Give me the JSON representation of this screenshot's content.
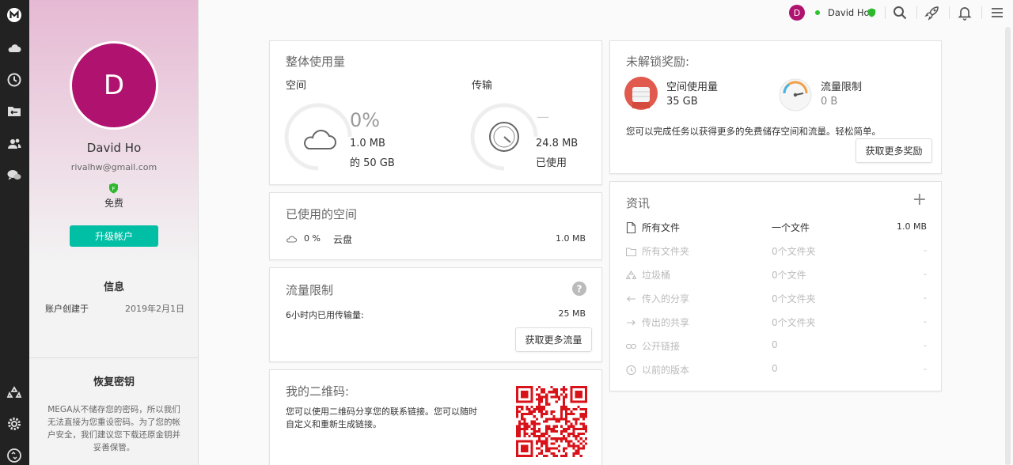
{
  "topbar": {
    "avatar_letter": "D",
    "user_name": "David Ho"
  },
  "sidebar": {
    "items": [
      {
        "icon": "mega-logo-icon"
      },
      {
        "icon": "cloud-drive-icon"
      },
      {
        "icon": "recents-clock-icon"
      },
      {
        "icon": "shared-folders-icon"
      },
      {
        "icon": "contacts-icon"
      },
      {
        "icon": "chat-icon"
      },
      {
        "icon": "rubbish-bin-icon"
      },
      {
        "icon": "settings-gear-icon"
      },
      {
        "icon": "transfer-status-icon"
      }
    ]
  },
  "profile": {
    "avatar_letter": "D",
    "name": "David Ho",
    "email": "rivalhw@gmail.com",
    "plan": "免费",
    "upgrade_label": "升级帐户",
    "info_title": "信息",
    "created_label": "账户创建于",
    "created_value": "2019年2月1日",
    "recovery_title": "恢复密钥",
    "recovery_text": "MEGA从不储存您的密码，所以我们无法直接为您重设密码。为了您的帐户安全，我们建议您下载还原金钥并妥善保管。"
  },
  "usage": {
    "title": "整体使用量",
    "space_label": "空间",
    "space_pct": "0%",
    "space_used": "1.0 MB",
    "space_total": "的 50 GB",
    "space_fraction": 0.0,
    "transfer_label": "传输",
    "transfer_pct": "—",
    "transfer_used": "24.8 MB",
    "transfer_used_label": "已使用"
  },
  "used_space": {
    "title": "已使用的空间",
    "pct": "0 %",
    "name": "云盘",
    "size": "1.0 MB"
  },
  "quota": {
    "title": "流量限制",
    "row_label": "6小时内已用传输量:",
    "row_value": "25 MB",
    "button": "获取更多流量"
  },
  "qr": {
    "title": "我的二维码:",
    "text": "您可以使用二维码分享您的联系链接。您可以随时自定义和重新生成链接。"
  },
  "rewards": {
    "title": "未解锁奖励:",
    "space_label": "空间使用量",
    "space_value": "35 GB",
    "transfer_label": "流量限制",
    "transfer_value": "0 B",
    "note": "您可以完成任务以获得更多的免费储存空间和流量。轻松简单。",
    "button": "获取更多奖励"
  },
  "info": {
    "title": "资讯",
    "add_symbol": "+",
    "rows": [
      {
        "icon": "file-icon",
        "label": "所有文件",
        "count": "一个文件",
        "size": "1.0 MB"
      },
      {
        "icon": "folder-icon",
        "label": "所有文件夹",
        "count": "0个文件夹",
        "size": "-"
      },
      {
        "icon": "rubbish-icon",
        "label": "垃圾桶",
        "count": "0个文件",
        "size": "-"
      },
      {
        "icon": "incoming-share-icon",
        "label": "传入的分享",
        "count": "0个文件夹",
        "size": "-"
      },
      {
        "icon": "outgoing-share-icon",
        "label": "传出的共享",
        "count": "0个文件夹",
        "size": "-"
      },
      {
        "icon": "link-icon",
        "label": "公开链接",
        "count": "0",
        "size": "-"
      },
      {
        "icon": "version-clock-icon",
        "label": "以前的版本",
        "count": "0",
        "size": "-"
      }
    ]
  },
  "colors": {
    "brand": "#b0126f",
    "accent": "#00bfa5",
    "online": "#30c130",
    "reward_red": "#e05a4d"
  }
}
